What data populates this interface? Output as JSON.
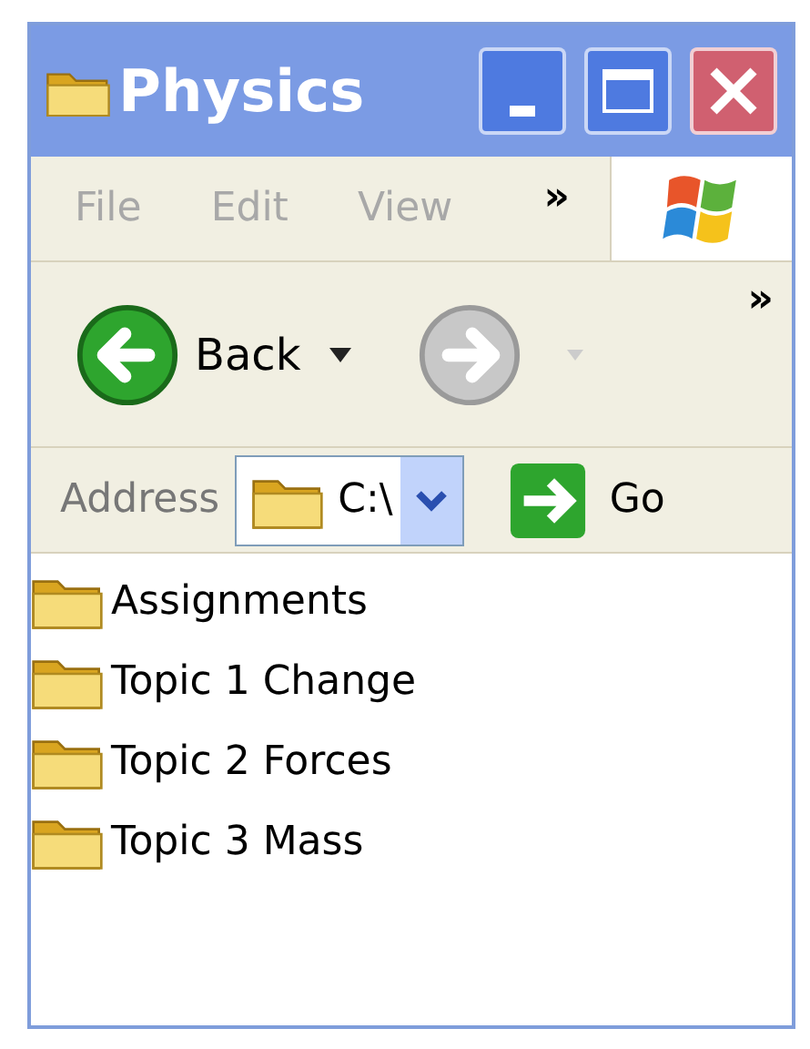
{
  "window": {
    "title": "Physics",
    "active": false
  },
  "menu": {
    "items": [
      "File",
      "Edit",
      "View"
    ],
    "overflow": "»"
  },
  "toolbar": {
    "back": {
      "label": "Back",
      "disabled": false
    },
    "forward": {
      "disabled": true
    },
    "overflow": "»"
  },
  "address": {
    "label": "Address",
    "value": "C:\\",
    "go": "Go"
  },
  "items": [
    {
      "name": "Assignments",
      "selected": false
    },
    {
      "name": "Topic 1 Change",
      "selected": false
    },
    {
      "name": "Topic 2 Forces",
      "selected": false
    },
    {
      "name": "Topic 3 Mass",
      "selected": false
    }
  ]
}
